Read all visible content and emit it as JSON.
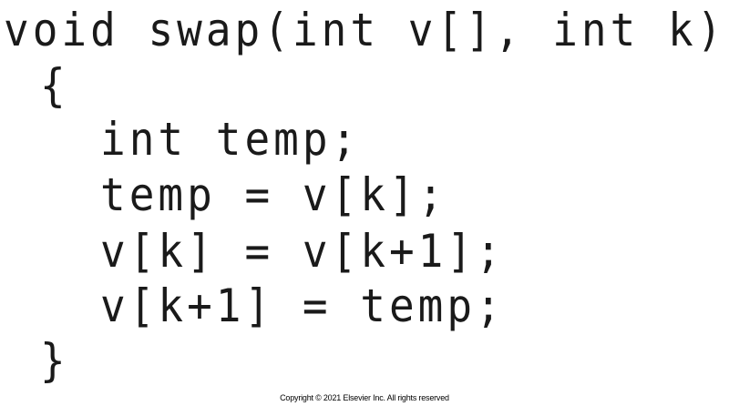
{
  "code": {
    "lines": [
      "void swap(int v[], int k)",
      "{",
      "int temp;",
      "temp = v[k];",
      "v[k] = v[k+1];",
      "v[k+1] = temp;",
      "}"
    ]
  },
  "footer": {
    "copyright": "Copyright © 2021 Elsevier Inc. All rights reserved"
  }
}
